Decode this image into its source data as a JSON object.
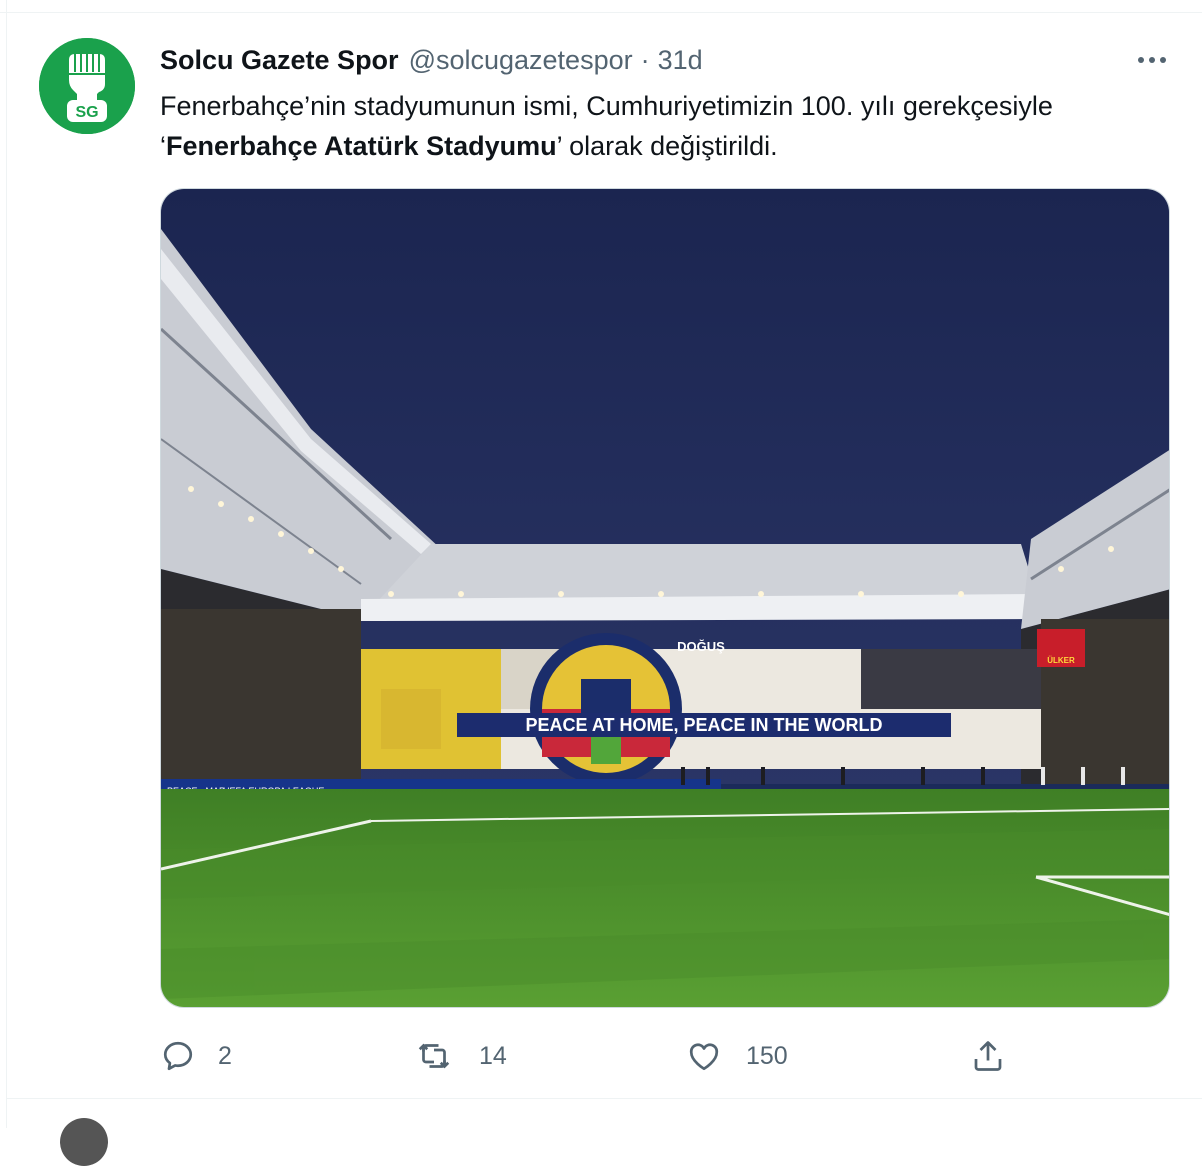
{
  "author": {
    "display_name": "Solcu Gazete Spor",
    "handle": "@solcugazetespor",
    "separator": "·",
    "time": "31d",
    "avatar_text": "SG"
  },
  "tweet": {
    "text_part1": "Fenerbahçe’nin stadyumunun ismi, Cumhuriyetimizin 100. yılı gerekçesiyle ‘",
    "text_bold": "Fenerbahçe Atatürk Stadyumu",
    "text_part2": "’ olarak değiştirildi."
  },
  "media": {
    "banner_text": "PEACE AT HOME, PEACE IN THE WORLD",
    "board_labels": [
      "PEACE - MAP",
      "UEFA EUROPA LEAGUE"
    ],
    "stand_logos": [
      "DOĞUŞ",
      "ÜLKER"
    ]
  },
  "actions": {
    "reply_count": "2",
    "retweet_count": "14",
    "like_count": "150"
  },
  "icons": {
    "reply": "reply-icon",
    "retweet": "retweet-icon",
    "like": "heart-icon",
    "share": "share-icon",
    "more": "more-icon"
  },
  "colors": {
    "avatar_green": "#1aa14c",
    "secondary_text": "#536471",
    "sky": "#1f2a55",
    "pitch": "#4f8f2d"
  }
}
